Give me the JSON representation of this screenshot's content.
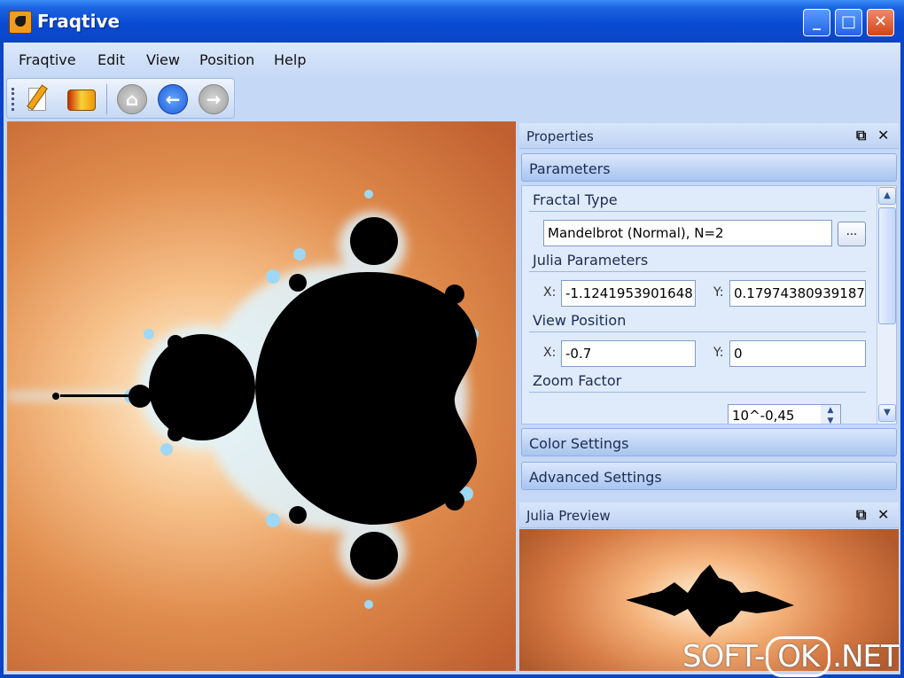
{
  "window": {
    "title": "Fraqtive"
  },
  "menu": [
    "Fraqtive",
    "Edit",
    "View",
    "Position",
    "Help"
  ],
  "toolbar": {
    "icons": [
      "edit-icon",
      "gradient-icon",
      "home-icon",
      "back-icon",
      "forward-icon"
    ]
  },
  "properties": {
    "title": "Properties",
    "sections": {
      "parameters": "Parameters",
      "color": "Color Settings",
      "advanced": "Advanced Settings"
    },
    "fractal_type": {
      "label": "Fractal Type",
      "value": "Mandelbrot (Normal), N=2",
      "button": "..."
    },
    "julia": {
      "label": "Julia Parameters",
      "x_label": "X:",
      "x_value": "-1.1241953901648",
      "y_label": "Y:",
      "y_value": "0.17974380939187"
    },
    "view_position": {
      "label": "View Position",
      "x_label": "X:",
      "x_value": "-0.7",
      "y_label": "Y:",
      "y_value": "0"
    },
    "zoom": {
      "label": "Zoom Factor",
      "value": "10^-0,45"
    }
  },
  "julia_preview": {
    "title": "Julia Preview"
  },
  "watermark": {
    "pre": "SOFT-",
    "ok": "OK",
    "post": ".NET"
  },
  "colors": {
    "title_blue": "#0a4bd3",
    "fractal_orange": "#e08c4d",
    "panel_blue": "#c5d8f5"
  }
}
